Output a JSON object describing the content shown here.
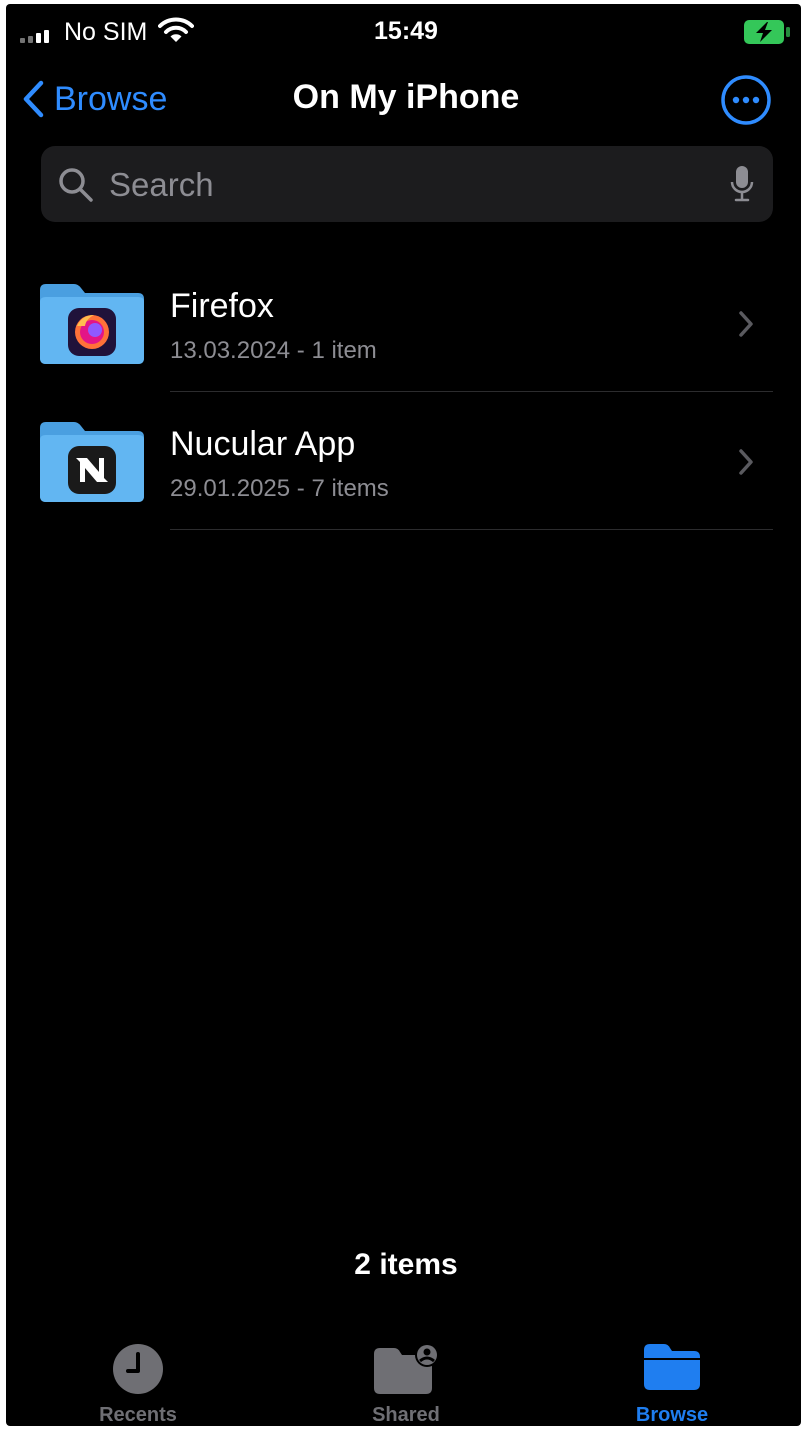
{
  "status_bar": {
    "carrier": "No SIM",
    "time": "15:49",
    "battery_color": "#34c759"
  },
  "nav": {
    "back_label": "Browse",
    "title": "On My iPhone"
  },
  "search": {
    "placeholder": "Search"
  },
  "files": [
    {
      "name": "Firefox",
      "meta": "13.03.2024 - 1 item",
      "icon": "firefox-icon"
    },
    {
      "name": "Nucular App",
      "meta": "29.01.2025 - 7 items",
      "icon": "nucular-app-icon"
    }
  ],
  "footer": {
    "item_count": "2 items"
  },
  "tabs": [
    {
      "label": "Recents",
      "icon": "clock-icon",
      "active": false
    },
    {
      "label": "Shared",
      "icon": "shared-folder-icon",
      "active": false
    },
    {
      "label": "Browse",
      "icon": "folder-icon",
      "active": true
    }
  ],
  "colors": {
    "accent": "#2f8cff",
    "background": "#000000",
    "folder": "#5fb3f0",
    "secondary_text": "#8d8d93"
  }
}
